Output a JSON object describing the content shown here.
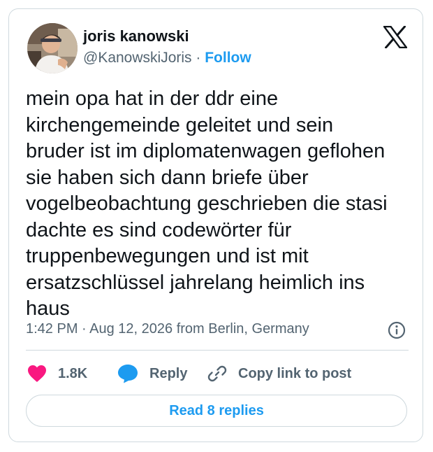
{
  "author": {
    "name": "joris kanowski",
    "handle": "@KanowskiJoris",
    "separator": "·",
    "follow_label": "Follow",
    "avatar_icon": "profile-photo"
  },
  "brand": {
    "logo_icon": "x-logo",
    "accent_color": "#1d9bf0"
  },
  "tweet": {
    "text": "mein opa hat in der ddr eine\nkirchengemeinde geleitet und sein\nbruder ist im diplomatenwagen geflohen\nsie haben sich dann briefe über\nvogelbeobachtung geschrieben die stasi\ndachte es sind codewörter für\ntruppenbewegungen und ist mit\nersatzschlüssel jahrelang heimlich ins\nhaus"
  },
  "meta": {
    "timestamp": "1:42 PM · Aug 12, 2026 from Berlin, Germany",
    "info_icon": "info-icon"
  },
  "actions": {
    "likes": "1.8K",
    "like_icon": "heart-icon",
    "like_color": "#f91880",
    "reply_label": "Reply",
    "reply_icon": "speech-bubble-icon",
    "copy_label": "Copy link to post",
    "copy_icon": "link-icon"
  },
  "footer": {
    "read_replies_label": "Read 8 replies"
  }
}
